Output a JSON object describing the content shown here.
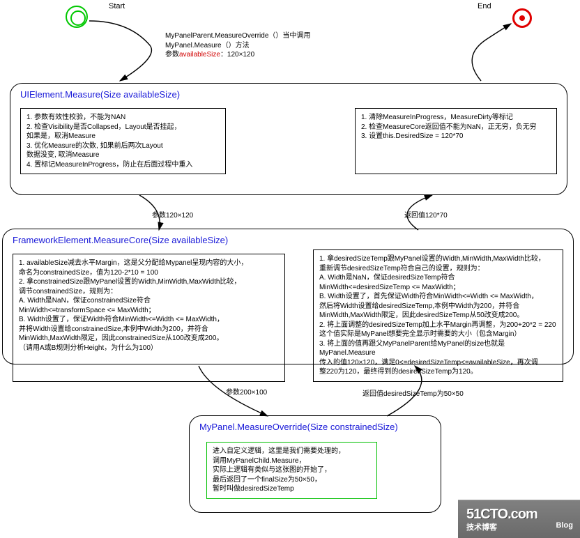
{
  "labels": {
    "start": "Start",
    "end": "End"
  },
  "call_text": {
    "line1": "MyPanelParent.MeasureOverride（）当中调用",
    "line2": "MyPanel.Measure（）方法",
    "line3_prefix": "参数",
    "line3_red": "availableSize",
    "line3_suffix": "：120×120"
  },
  "box1": {
    "title": "UIElement.Measure(Size availableSize)",
    "col1": "1. 参数有效性校验，不能为NAN\n2. 检查Visibility是否Collapsed，Layout是否挂起，\n    如果是，取消Measure\n3. 优化Measure的次数, 如果前后两次Layout\n    数据没变, 取消Measure\n4. 置标记MeasureInProgress，防止在后面过程中重入",
    "col2": "1. 清除MeasureInProgress，MeasureDirty等标记\n2. 检查MeasureCore返回值不能为NaN，正无穷，负无穷\n3. 设置this.DesiredSize = 120*70"
  },
  "box2": {
    "title": "FrameworkElement.MeasureCore(Size availableSize)",
    "col1": "1. availableSize减去水平Margin，这是父分配给Mypanel呈现内容的大小，\n   命名为constrainedSize，值为120-2*10 = 100\n2. 拿constrainedSize跟MyPanel设置的Width,MinWidth,MaxWidth比较，\n   调节constrainedSize，规则为：\n   A.  Width是NaN，保证constrainedSize符合\n        MinWidth<=transformSpace <= MaxWidth；\n   B.  Width设置了，保证Width符合MinWidth<=Width <= MaxWidth，\n        并将Width设置给constrainedSize,本例中Width为200，并符合\n        MinWidth,MaxWidth限定，因此constrainedSize从100改变成200。\n   （请用A或B规则分析Height，为什么为100）",
    "col2": "1. 拿desiredSizeTemp跟MyPanel设置的Width,MinWidth,MaxWidth比较，\n   重新调节desiredSizeTemp符合自己的设置，规则为：\n   A.  Width是NaN，保证desiredSizeTemp符合\n        MinWidth<=desiredSizeTemp <= MaxWidth；\n   B.  Width设置了，首先保证Width符合MinWidth<=Width <= MaxWidth，\n        然后将Width设置给desiredSizeTemp,本例中Width为200，并符合\n        MinWidth,MaxWidth限定，因此desiredSizeTemp从50改变成200。\n2. 将上面调整的desiredSizeTemp加上水平Margin再调整，为200+20*2 = 220\n   这个值实际是MyPanel想要完全显示时需要的大小（包含Margin）\n3. 将上面的值再跟父MyPanelParent给MyPanel的size也就是MyPanel.Measure\n   传入的值120×120，满足0<=desiredSizeTemp<=availableSize，再次调\n   整220为120，最终得到的desiredSizeTemp为120。"
  },
  "box3": {
    "title": "MyPanel.MeasureOverride(Size constrainedSize)",
    "inner": "进入自定义逻辑，这里是我们需要处理的，\n调用MyPanelChild.Measure，\n实际上逻辑有类似与这张图的开始了，\n最后返回了一个finalSize为50×50，\n暂时叫做desiredSizeTemp"
  },
  "params": {
    "p1": "参数120×120",
    "p2": "参数200×100",
    "p3": "返回值desiredSizeTemp为50×50",
    "p4": "返回值120*70"
  },
  "footer": {
    "brand": "51CTO.com",
    "sub1": "技术博客",
    "sub2": "Blog"
  }
}
